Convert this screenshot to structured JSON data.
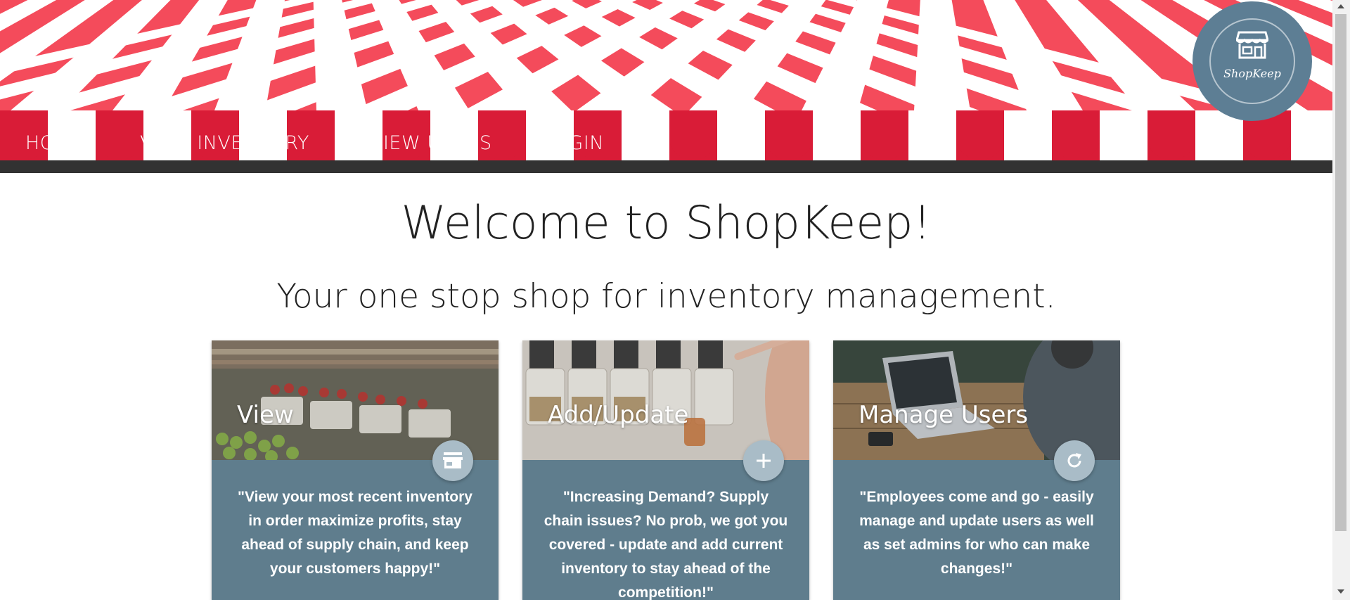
{
  "nav": {
    "items": [
      {
        "label": "HOME"
      },
      {
        "label": "VIEW INVENTORY"
      },
      {
        "label": "VIEW USERS"
      },
      {
        "label": "LOGIN"
      }
    ]
  },
  "logo": {
    "text": "ShopKeep",
    "icon": "storefront-icon"
  },
  "main": {
    "title": "Welcome to ShopKeep!",
    "subtitle": "Your one stop shop for inventory management."
  },
  "cards": [
    {
      "title": "View",
      "icon": "store-icon",
      "text": "\"View your most recent inventory in order maximize profits, stay ahead of supply chain, and keep your customers happy!\""
    },
    {
      "title": "Add/Update",
      "icon": "plus-icon",
      "text": "\"Increasing Demand? Supply chain issues? No prob, we got you covered - update and add current inventory to stay ahead of the competition!\""
    },
    {
      "title": "Manage Users",
      "icon": "refresh-icon",
      "text": "\"Employees come and go - easily manage and update users as well as set admins for who can make changes!\""
    }
  ],
  "colors": {
    "awning_red": "#f44b5b",
    "awning_dark_red": "#d91c37",
    "card_bg": "#5f7d8d",
    "logo_bg": "#5d7e94",
    "fab_bg": "#a9bcc7"
  }
}
